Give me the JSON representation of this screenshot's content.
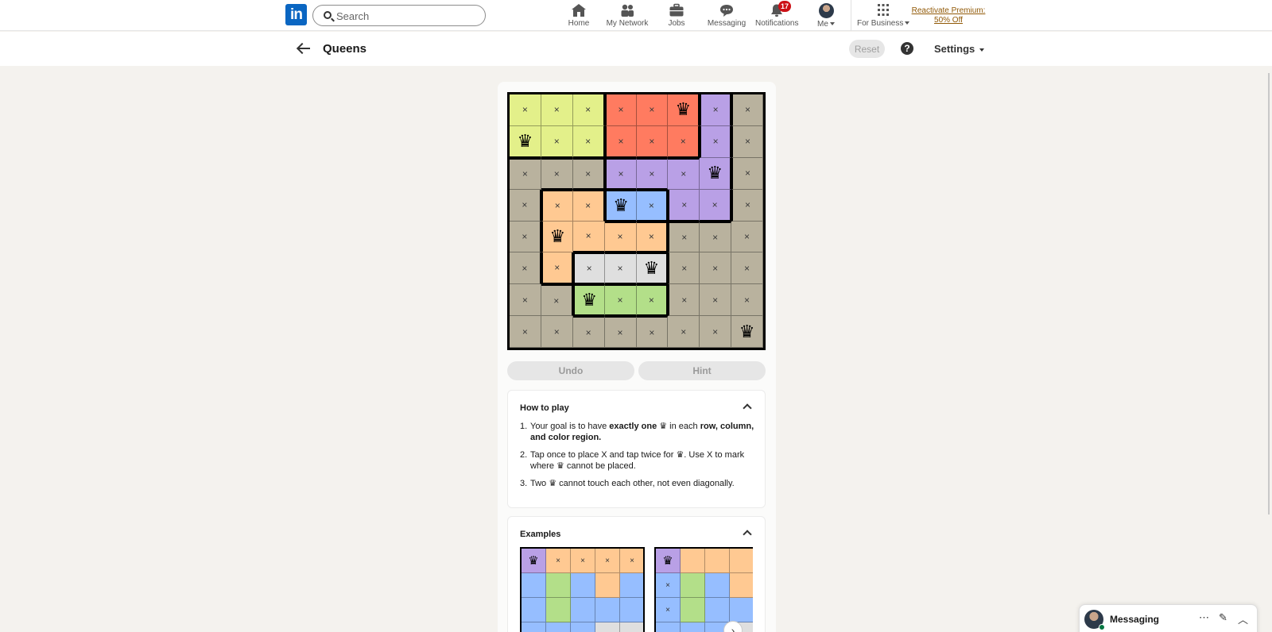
{
  "nav": {
    "logo": "in",
    "search_placeholder": "Search",
    "items": [
      {
        "label": "Home"
      },
      {
        "label": "My Network"
      },
      {
        "label": "Jobs"
      },
      {
        "label": "Messaging"
      },
      {
        "label": "Notifications",
        "badge": "17"
      },
      {
        "label": "Me"
      },
      {
        "label": "For Business"
      }
    ],
    "premium_line1": "Reactivate Premium:",
    "premium_line2": "50% Off"
  },
  "header": {
    "title": "Queens",
    "reset_label": "Reset",
    "help_label": "?",
    "settings_label": "Settings"
  },
  "board": {
    "size": 8,
    "colors": {
      "Y": "#e3f08a",
      "R": "#ff7b60",
      "P": "#b9a0e6",
      "G": "#b9b29e",
      "O": "#ffc992",
      "B": "#96beff",
      "W": "#dfdfdf",
      "L": "#b3df89"
    },
    "regions": [
      "YYYRRRPG",
      "YYYRRRPG",
      "GGGPPPPG",
      "GOOBBPPG",
      "GOOOOGGG",
      "GOWWWGGG",
      "GGLLLGGG",
      "GGGGGGGG"
    ],
    "marks": [
      "xxxxxQxx",
      "Qxxxxxxx",
      "xxxxxxQx",
      "xxxQxxxx",
      "xQxxxxxx",
      "xxxxQxxx",
      "xxQxxxxx",
      "xxxxxxxQ"
    ],
    "x_symbol": "×",
    "queen_symbol": "♛"
  },
  "controls": {
    "undo_label": "Undo",
    "hint_label": "Hint"
  },
  "how_to_play": {
    "title": "How to play",
    "rule1": {
      "n": "1.",
      "a": "Your goal is to have ",
      "b": "exactly one",
      "c": " ♛ in each ",
      "d": "row, column, and color region."
    },
    "rule2": {
      "n": "2.",
      "text": "Tap once to place X and tap twice for ♛. Use X to mark where ♛ cannot be placed."
    },
    "rule3": {
      "n": "3.",
      "text": "Two ♛ cannot touch each other, not even diagonally."
    }
  },
  "examples": {
    "title": "Examples",
    "next_label": "›"
  },
  "messaging": {
    "label": "Messaging"
  }
}
